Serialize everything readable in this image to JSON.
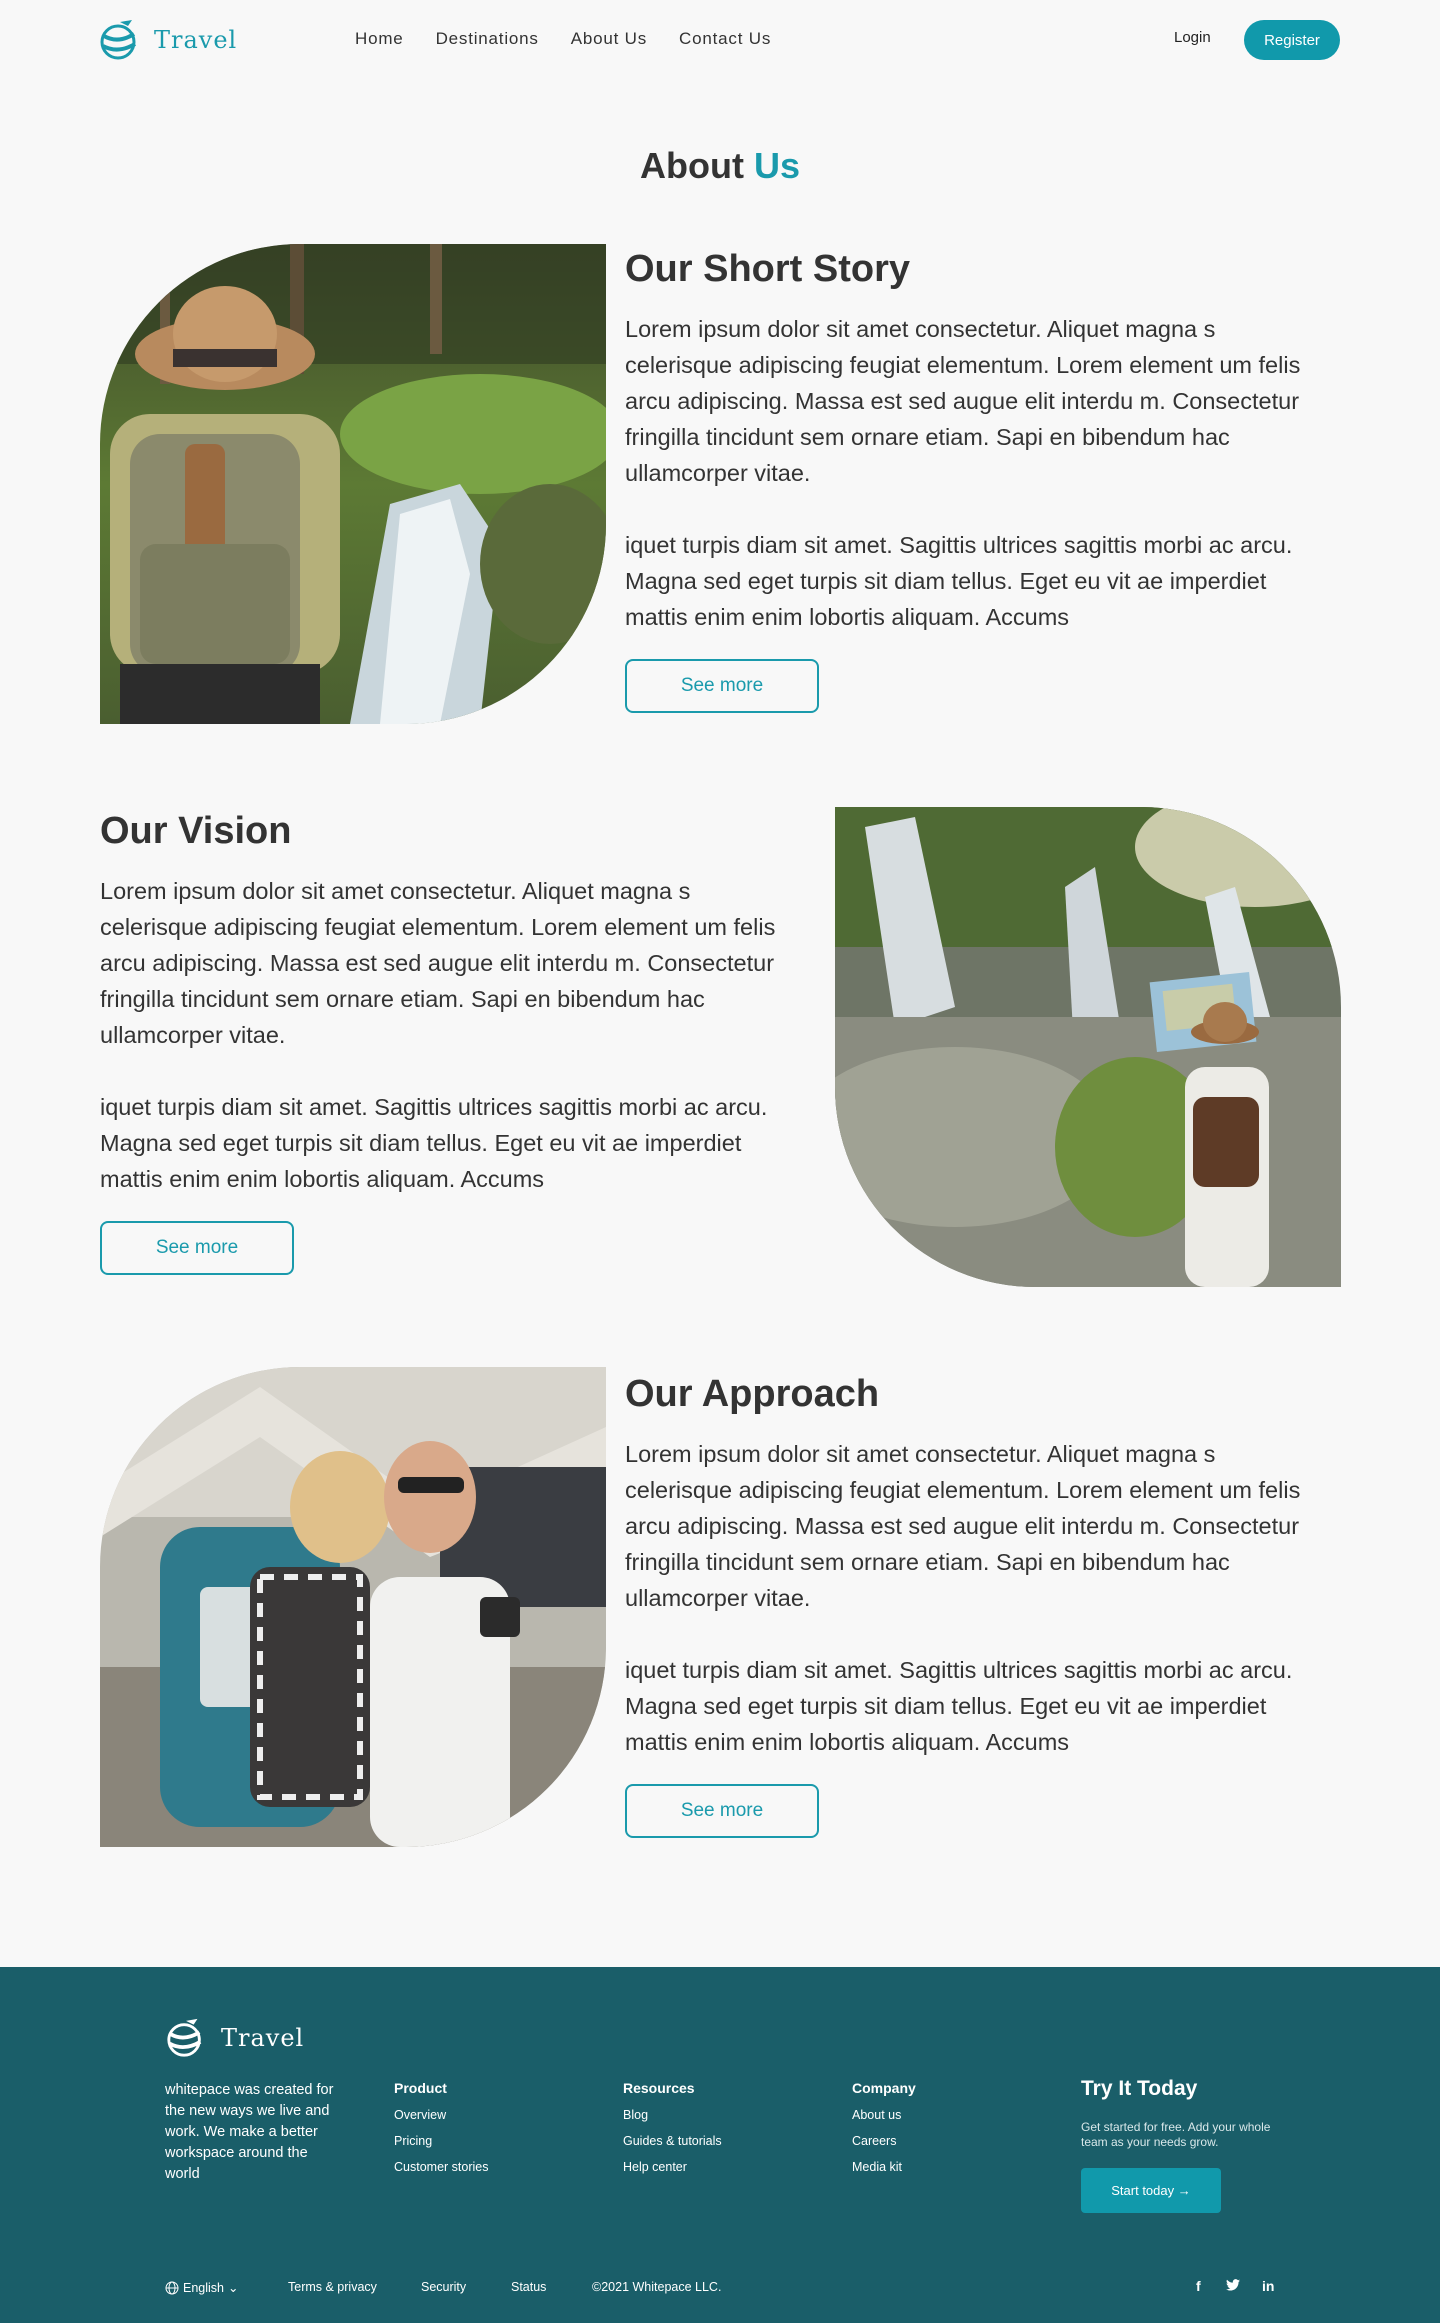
{
  "nav": {
    "brand": "Travel",
    "links": [
      "Home",
      "Destinations",
      "About Us",
      "Contact Us"
    ],
    "login": "Login",
    "register": "Register"
  },
  "page_title": {
    "main": "About",
    "accent": "Us"
  },
  "sections": [
    {
      "title": "Our Short Story",
      "p1": "Lorem ipsum dolor sit amet consectetur. Aliquet magna s celerisque adipiscing feugiat elementum. Lorem element um felis arcu adipiscing. Massa est sed augue elit interdu m. Consectetur fringilla tincidunt sem ornare etiam. Sapi en bibendum hac ullamcorper vitae.",
      "p2": "iquet turpis diam sit amet. Sagittis ultrices sagittis morbi ac arcu. Magna sed eget turpis sit diam tellus. Eget eu vit ae imperdiet mattis enim enim lobortis aliquam. Accums",
      "button": "See more"
    },
    {
      "title": "Our Vision",
      "p1": "Lorem ipsum dolor sit amet consectetur. Aliquet magna s celerisque adipiscing feugiat elementum. Lorem element um felis arcu adipiscing. Massa est sed augue elit interdu m. Consectetur fringilla tincidunt sem ornare etiam. Sapi en bibendum hac ullamcorper vitae.",
      "p2": "iquet turpis diam sit amet. Sagittis ultrices sagittis morbi ac arcu. Magna sed eget turpis sit diam tellus. Eget eu vit ae imperdiet mattis enim enim lobortis aliquam. Accums",
      "button": "See more"
    },
    {
      "title": "Our Approach",
      "p1": "Lorem ipsum dolor sit amet consectetur. Aliquet magna s celerisque adipiscing feugiat elementum. Lorem element um felis arcu adipiscing. Massa est sed augue elit interdu m. Consectetur fringilla tincidunt sem ornare etiam. Sapi en bibendum hac ullamcorper vitae.",
      "p2": "iquet turpis diam sit amet. Sagittis ultrices sagittis morbi ac arcu. Magna sed eget turpis sit diam tellus. Eget eu vit ae imperdiet mattis enim enim lobortis aliquam. Accums",
      "button": "See more"
    }
  ],
  "footer": {
    "brand": "Travel",
    "about": "whitepace was created for the new ways we live and work. We make a better workspace around the world",
    "product": {
      "title": "Product",
      "items": [
        "Overview",
        "Pricing",
        "Customer stories"
      ]
    },
    "resources": {
      "title": "Resources",
      "items": [
        "Blog",
        "Guides & tutorials",
        "Help center"
      ]
    },
    "company": {
      "title": "Company",
      "items": [
        "About us",
        "Careers",
        "Media kit"
      ]
    },
    "try": {
      "title": "Try It Today",
      "subtitle": "Get started for free. Add your whole team as your needs grow.",
      "button": "Start today"
    },
    "bottom": {
      "language": "English",
      "terms": "Terms & privacy",
      "security": "Security",
      "status": "Status",
      "copyright": "©2021 Whitepace LLC."
    },
    "social": [
      "f",
      "t",
      "in"
    ]
  },
  "colors": {
    "accent": "#1a9aac",
    "footer_bg": "#1a5e69",
    "button": "#1199ab"
  }
}
